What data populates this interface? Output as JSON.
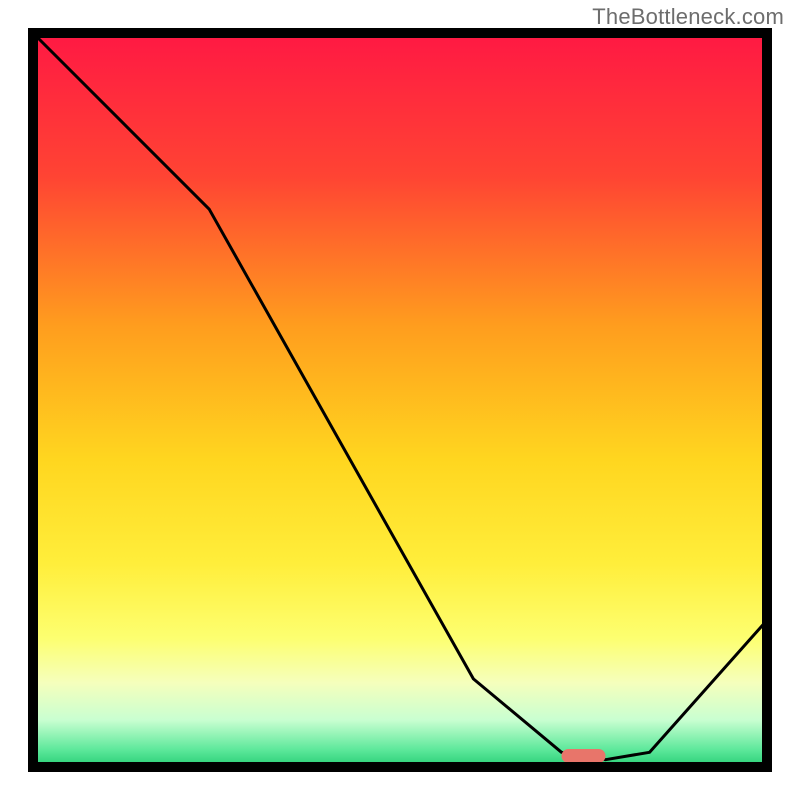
{
  "watermark": "TheBottleneck.com",
  "chart_data": {
    "type": "line",
    "title": "",
    "xlabel": "",
    "ylabel": "",
    "xlim": [
      0,
      100
    ],
    "ylim": [
      0,
      100
    ],
    "x": [
      0,
      12,
      24,
      60,
      72,
      78,
      84,
      100
    ],
    "values": [
      100,
      88,
      76,
      12,
      2,
      1,
      2,
      20
    ],
    "marker": {
      "x_start": 72,
      "x_end": 78,
      "y": 1.5
    },
    "background_gradient": [
      {
        "pos": 0.0,
        "color": "#ff1744"
      },
      {
        "pos": 0.2,
        "color": "#ff4433"
      },
      {
        "pos": 0.4,
        "color": "#ff9d1e"
      },
      {
        "pos": 0.58,
        "color": "#ffd61f"
      },
      {
        "pos": 0.72,
        "color": "#ffee3b"
      },
      {
        "pos": 0.82,
        "color": "#fdff70"
      },
      {
        "pos": 0.88,
        "color": "#f5ffbc"
      },
      {
        "pos": 0.93,
        "color": "#c9ffd1"
      },
      {
        "pos": 0.97,
        "color": "#5de89b"
      },
      {
        "pos": 1.0,
        "color": "#18c66a"
      }
    ],
    "curve_color": "#000000",
    "marker_color": "#e8756a",
    "border_color": "#000000",
    "border_width": 10
  }
}
